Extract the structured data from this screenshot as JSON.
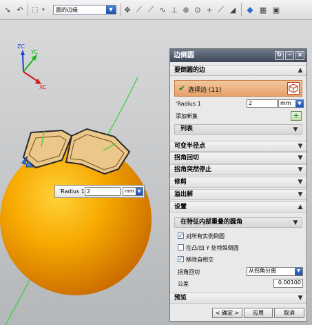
{
  "toolbar": {
    "filter_value": "面的边缘"
  },
  "triad": {
    "zc": "ZC",
    "yc": "YC",
    "xc": "XC"
  },
  "floating_radius": {
    "label": "Radius 1",
    "value": "2",
    "unit": "mm"
  },
  "dialog": {
    "title": "边倒圆",
    "sections": {
      "edges": "要倒圆的边",
      "variable_radius": "可变半径点",
      "corner_setback": "拐角回切",
      "corner_stop": "拐角突然停止",
      "trim": "修剪",
      "overflow": "溢出解",
      "settings": "设置",
      "preview": "预览"
    },
    "select_edge": "选择边 (11)",
    "radius_label": "Radius 1",
    "radius_value": "2",
    "radius_unit": "mm",
    "add_new_set": "添加新集",
    "list": "列表",
    "settings_dropdown": "在特征内部重叠的圆角",
    "checks": [
      {
        "label": "对所有实例倒圆",
        "checked": true
      },
      {
        "label": "在凸/凹 Y 处特殊倒圆",
        "checked": false
      },
      {
        "label": "移除自相交",
        "checked": true
      }
    ],
    "corner_setback_label": "拐角回切",
    "corner_setback_value": "从拐角分离",
    "tolerance_label": "公差",
    "tolerance_value": "0.00100",
    "buttons": {
      "ok": "< 确定 >",
      "apply": "应用",
      "cancel": "取消"
    }
  }
}
